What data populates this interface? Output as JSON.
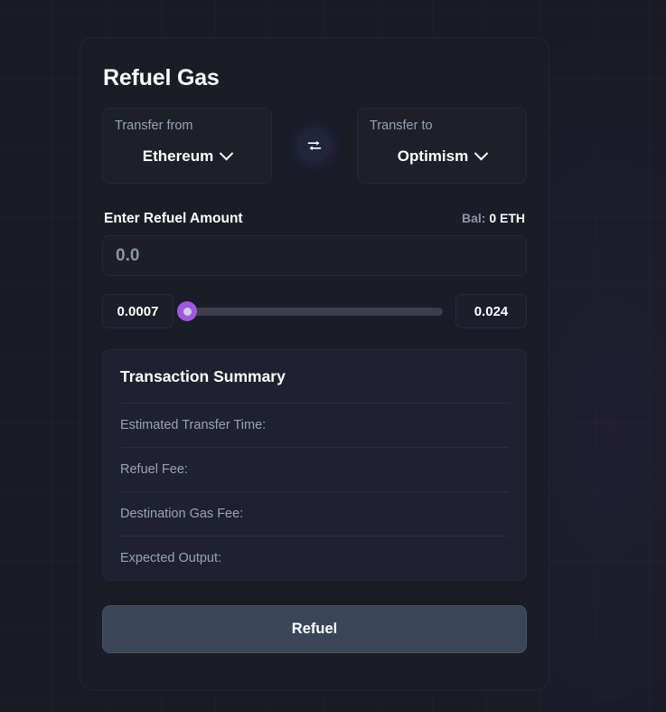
{
  "card": {
    "title": "Refuel Gas"
  },
  "transfer": {
    "from": {
      "label": "Transfer from",
      "value": "Ethereum",
      "chevron_icon": "chevron-down-icon"
    },
    "to": {
      "label": "Transfer to",
      "value": "Optimism",
      "chevron_icon": "chevron-down-icon"
    },
    "swap_icon": "swap-horizontal-icon"
  },
  "amount": {
    "title": "Enter Refuel Amount",
    "balance_label": "Bal:",
    "balance_value": "0 ETH",
    "input_value": "",
    "input_placeholder": "0.0"
  },
  "slider": {
    "min_label": "0.0007",
    "max_label": "0.024",
    "thumb_color": "#a158e0",
    "track_color": "#3b3e4d",
    "position_percent": 0
  },
  "summary": {
    "title": "Transaction Summary",
    "rows": [
      {
        "key": "Estimated Transfer Time:",
        "value": ""
      },
      {
        "key": "Refuel Fee:",
        "value": ""
      },
      {
        "key": "Destination Gas Fee:",
        "value": ""
      },
      {
        "key": "Expected Output:",
        "value": ""
      }
    ]
  },
  "action": {
    "refuel_label": "Refuel"
  },
  "colors": {
    "page_background": "#191b26",
    "card_background": "#1a1c27",
    "summary_background": "#1f2130",
    "accent_purple": "#a158e0",
    "button_background": "#3a4558"
  }
}
